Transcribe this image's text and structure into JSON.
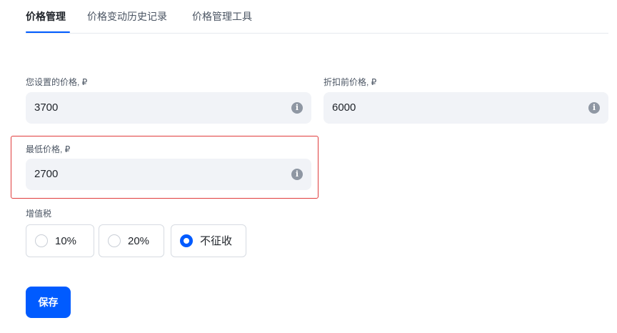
{
  "tabs": [
    {
      "label": "价格管理",
      "active": true
    },
    {
      "label": "价格变动历史记录",
      "active": false
    },
    {
      "label": "价格管理工具",
      "active": false
    }
  ],
  "fields": {
    "your_price": {
      "label": "您设置的价格, ₽",
      "value": "3700"
    },
    "price_before_discount": {
      "label": "折扣前价格, ₽",
      "value": "6000"
    },
    "min_price": {
      "label": "最低价格, ₽",
      "value": "2700"
    }
  },
  "vat": {
    "label": "增值税",
    "options": [
      {
        "label": "10%",
        "selected": false
      },
      {
        "label": "20%",
        "selected": false
      },
      {
        "label": "不征收",
        "selected": true
      }
    ]
  },
  "save_label": "保存",
  "icons": {
    "info": "i"
  },
  "colors": {
    "accent": "#005bff",
    "highlight": "#e03c3c",
    "field_bg": "#f1f3f7"
  }
}
